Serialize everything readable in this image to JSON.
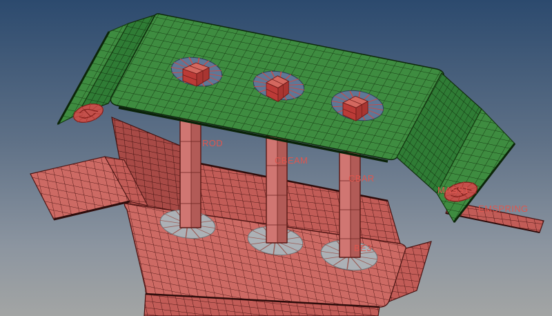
{
  "viewport": {
    "description_labels": {
      "rod": "ROD",
      "cbeam": "CBEAM",
      "cbar": "CBAR",
      "mass1": "MASS1",
      "emspring": "EMSPRING",
      "rbe3_partial": "BE3"
    }
  },
  "colors": {
    "background_top": "#2C4A6E",
    "background_mid": "#5F7187",
    "background_bottom": "#A3A5A4",
    "top_plate_green": "#3E8C40",
    "top_plate_wall_green": "#2F7C35",
    "bottom_plate_red": "#CD6A64",
    "bottom_plate_wall_red": "#C25C57",
    "interior_wall_red": "#A84A46",
    "column_red_light": "#D07672",
    "column_red_dark": "#B25B57",
    "hole_fill_top_plate": "#5F7796",
    "hole_fill_bottom_plate": "#ACB1B6",
    "connector_red": "#C4504B",
    "spider_ray_red": "#CB4A46",
    "label_text": "#DE564E"
  }
}
